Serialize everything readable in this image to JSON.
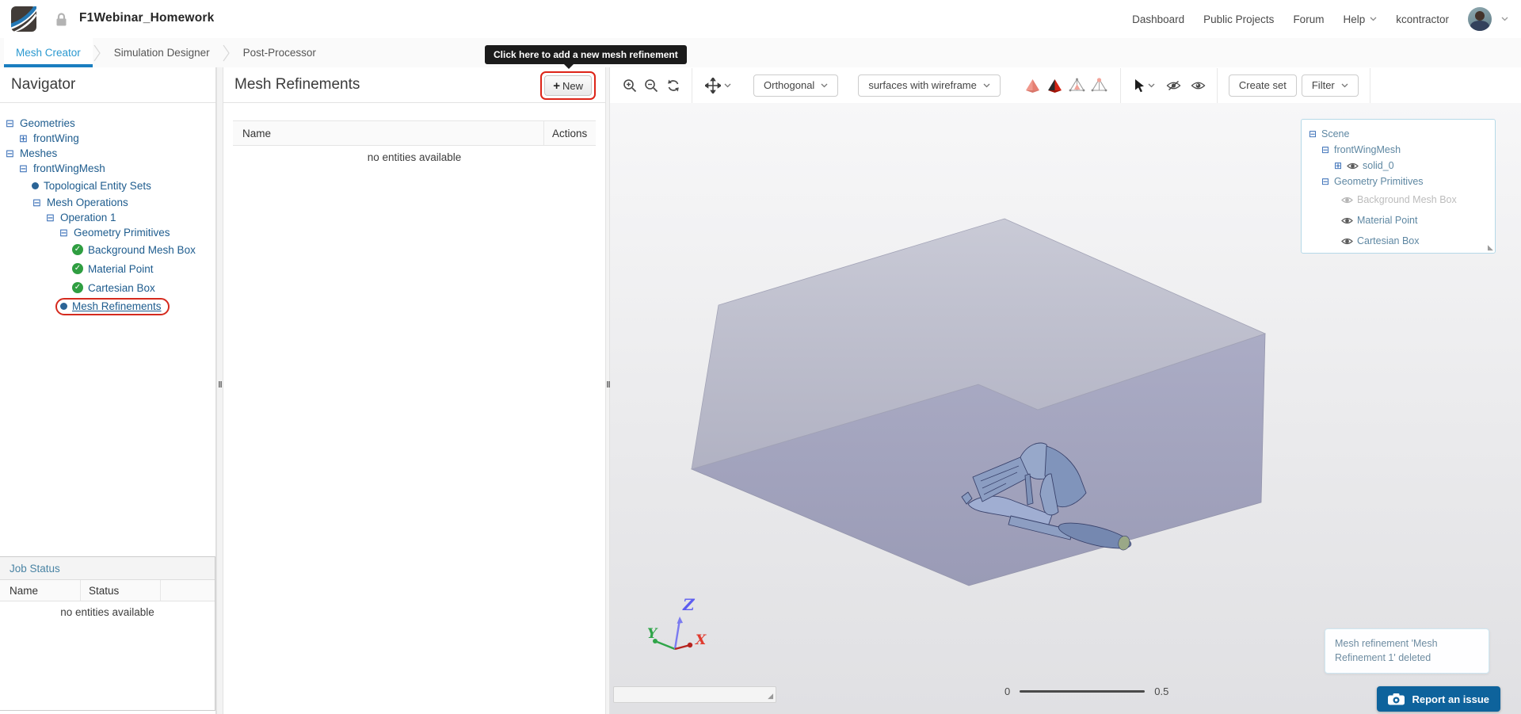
{
  "colors": {
    "accent_blue": "#2b99d0",
    "tab_underline": "#1a7ec0",
    "red_highlight": "#d52a1e",
    "tree_text": "#1e5c8e",
    "scene_text": "#5e87a2",
    "muted_item": "#bcbcbc",
    "check_green": "#2f9e41",
    "dot_blue": "#2b6496",
    "report_button_bg": "#0e639c",
    "notification_text": "#6e8ca1",
    "axis_x": "#e03b2f",
    "axis_y": "#2fa549",
    "axis_z": "#5c5cf0"
  },
  "header": {
    "title": "F1Webinar_Homework",
    "nav_items": [
      "Dashboard",
      "Public Projects",
      "Forum"
    ],
    "help_label": "Help",
    "username": "kcontractor"
  },
  "tabs": [
    {
      "label": "Mesh Creator",
      "active": true
    },
    {
      "label": "Simulation Designer",
      "active": false
    },
    {
      "label": "Post-Processor",
      "active": false
    }
  ],
  "tooltip": {
    "text": "Click here to add a new mesh refinement"
  },
  "navigator": {
    "title": "Navigator",
    "items": [
      {
        "label": "Geometries",
        "icon": "minus-box",
        "depth": 0
      },
      {
        "label": "frontWing",
        "icon": "plus-box",
        "depth": 1
      },
      {
        "label": "Meshes",
        "icon": "minus-box",
        "depth": 0
      },
      {
        "label": "frontWingMesh",
        "icon": "minus-box",
        "depth": 1
      },
      {
        "label": "Topological Entity Sets",
        "icon": "dot",
        "depth": 2
      },
      {
        "label": "Mesh Operations",
        "icon": "minus-box",
        "depth": 2
      },
      {
        "label": "Operation 1",
        "icon": "minus-box",
        "depth": 3
      },
      {
        "label": "Geometry Primitives",
        "icon": "minus-box",
        "depth": 4
      },
      {
        "label": "Background Mesh Box",
        "icon": "check",
        "depth": 5
      },
      {
        "label": "Material Point",
        "icon": "check",
        "depth": 5
      },
      {
        "label": "Cartesian Box",
        "icon": "check",
        "depth": 5
      },
      {
        "label": "Mesh Refinements",
        "icon": "dot",
        "depth": 4,
        "selected": true
      }
    ]
  },
  "mesh_panel": {
    "title": "Mesh Refinements",
    "new_button": {
      "plus": "+",
      "label": "New"
    },
    "table": {
      "columns": [
        "Name",
        "Actions"
      ],
      "empty": "no entities available"
    }
  },
  "job_status": {
    "title": "Job Status",
    "columns": [
      "Name",
      "Status"
    ],
    "empty": "no entities available"
  },
  "viewport": {
    "toolbar": {
      "projection": "Orthogonal",
      "render_mode": "surfaces with wireframe",
      "create_set": "Create set",
      "filter": "Filter"
    },
    "scene_tree": [
      {
        "label": "Scene",
        "toggle": "minus",
        "eye": false,
        "depth": 0
      },
      {
        "label": "frontWingMesh",
        "toggle": "minus",
        "eye": false,
        "depth": 1
      },
      {
        "label": "solid_0",
        "toggle": "plus",
        "eye": true,
        "depth": 2
      },
      {
        "label": "Geometry Primitives",
        "toggle": "minus",
        "eye": false,
        "depth": 1
      },
      {
        "label": "Background Mesh Box",
        "toggle": null,
        "eye": true,
        "muted": true,
        "depth": 2
      },
      {
        "label": "Material Point",
        "toggle": null,
        "eye": true,
        "depth": 2
      },
      {
        "label": "Cartesian Box",
        "toggle": null,
        "eye": true,
        "depth": 2
      }
    ],
    "axes": {
      "x": "X",
      "y": "Y",
      "z": "Z"
    },
    "scale_bar": {
      "min": "0",
      "max": "0.5"
    },
    "notification": "Mesh refinement 'Mesh Refinement 1' deleted",
    "report_issue": "Report an issue"
  },
  "glyphs": {
    "minus_box": "⊟",
    "plus_box": "⊞",
    "check": "✓",
    "grip": "‖",
    "resize": "◢"
  }
}
